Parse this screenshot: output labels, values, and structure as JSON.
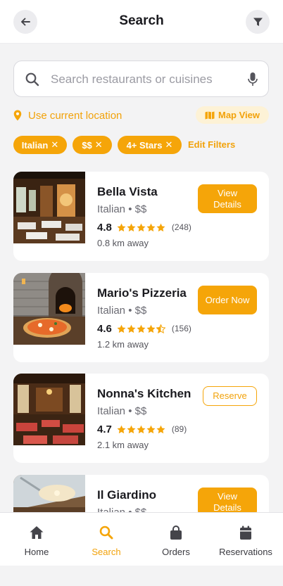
{
  "header": {
    "title": "Search",
    "back_icon": "arrow-left-icon",
    "filter_icon": "filter-icon"
  },
  "search": {
    "placeholder": "Search restaurants or cuisines",
    "value": "",
    "icon": "search-icon",
    "mic_icon": "microphone-icon"
  },
  "location": {
    "label": "Use current location",
    "icon": "map-pin-icon"
  },
  "map_view": {
    "label": "Map View",
    "icon": "map-icon"
  },
  "filters": {
    "chips": [
      {
        "label": "Italian"
      },
      {
        "label": "$$"
      },
      {
        "label": "4+ Stars"
      }
    ],
    "remove_glyph": "✕",
    "edit_label": "Edit Filters"
  },
  "restaurants": [
    {
      "name": "Bella Vista",
      "cuisine": "Italian",
      "price": "$$",
      "meta": "Italian • $$",
      "rating": "4.8",
      "stars": 5,
      "reviews": "(248)",
      "distance": "0.8 km away",
      "action": "View Details",
      "action_style": "filled"
    },
    {
      "name": "Mario's Pizzeria",
      "cuisine": "Italian",
      "price": "$$",
      "meta": "Italian • $$",
      "rating": "4.6",
      "stars": 4.5,
      "reviews": "(156)",
      "distance": "1.2 km away",
      "action": "Order Now",
      "action_style": "filled"
    },
    {
      "name": "Nonna's Kitchen",
      "cuisine": "Italian",
      "price": "$$",
      "meta": "Italian • $$",
      "rating": "4.7",
      "stars": 5,
      "reviews": "(89)",
      "distance": "2.1 km away",
      "action": "Reserve",
      "action_style": "outline"
    },
    {
      "name": "Il Giardino",
      "cuisine": "Italian",
      "price": "$$",
      "meta": "Italian • $$",
      "action": "View Details",
      "action_style": "filled"
    }
  ],
  "tabbar": {
    "items": [
      {
        "label": "Home",
        "icon": "home-icon"
      },
      {
        "label": "Search",
        "icon": "search-icon",
        "active": true
      },
      {
        "label": "Orders",
        "icon": "shopping-bag-icon"
      },
      {
        "label": "Reservations",
        "icon": "calendar-icon"
      }
    ]
  },
  "colors": {
    "accent": "#f5a509",
    "accent_text": "#f2a20a",
    "background": "#f3f3f4",
    "card": "#ffffff"
  }
}
